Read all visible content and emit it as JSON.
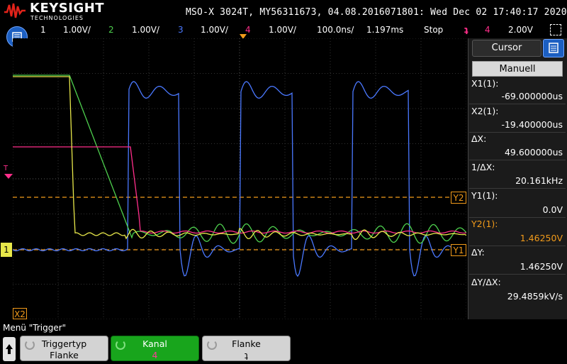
{
  "header": {
    "logo_text": "KEYSIGHT",
    "logo_sub": "TECHNOLOGIES",
    "title": "MSO-X 3024T, MY56311673, 04.08.2016071801: Wed Dec 02 17:40:17 2020"
  },
  "status": {
    "ch1_num": "1",
    "ch1_scale": "1.00V/",
    "ch2_num": "2",
    "ch2_scale": "1.00V/",
    "ch3_num": "3",
    "ch3_scale": "1.00V/",
    "ch4_num": "4",
    "ch4_scale": "1.00V/",
    "timebase": "100.0ns/",
    "delay": "1.197ms",
    "run_state": "Stop",
    "trigger_icon": "trigger-edge-falling-icon",
    "trigger_channel": "4",
    "trigger_level": "2.00V",
    "colors": {
      "ch1": "#e8e84a",
      "ch2": "#4ed14e",
      "ch3": "#4a78ff",
      "ch4": "#ff2e8a",
      "accent": "#f29b1a"
    }
  },
  "markers": {
    "t_marker": "T",
    "y2": "Y2",
    "y1": "Y1",
    "x2": "X2",
    "gnd": "1"
  },
  "cursor_panel": {
    "title": "Cursor",
    "mode": "Manuell",
    "rows": [
      {
        "label": "X1(1):",
        "value": "-69.000000us"
      },
      {
        "label": "X2(1):",
        "value": "-19.400000us"
      },
      {
        "label": "ΔX:",
        "value": "49.600000us"
      },
      {
        "label": "1/ΔX:",
        "value": "20.161kHz"
      },
      {
        "label": "Y1(1):",
        "value": "0.0V"
      },
      {
        "label": "Y2(1):",
        "value": "1.46250V"
      },
      {
        "label": "ΔY:",
        "value": "1.46250V"
      },
      {
        "label": "ΔY/ΔX:",
        "value": "29.4859kV/s"
      }
    ]
  },
  "footer": {
    "menu_title": "Menü \"Trigger\"",
    "softkeys": [
      {
        "label": "Triggertyp",
        "value": "Flanke"
      },
      {
        "label": "Kanal",
        "value": "4"
      },
      {
        "label": "Flanke",
        "value": "ʇ"
      }
    ]
  }
}
